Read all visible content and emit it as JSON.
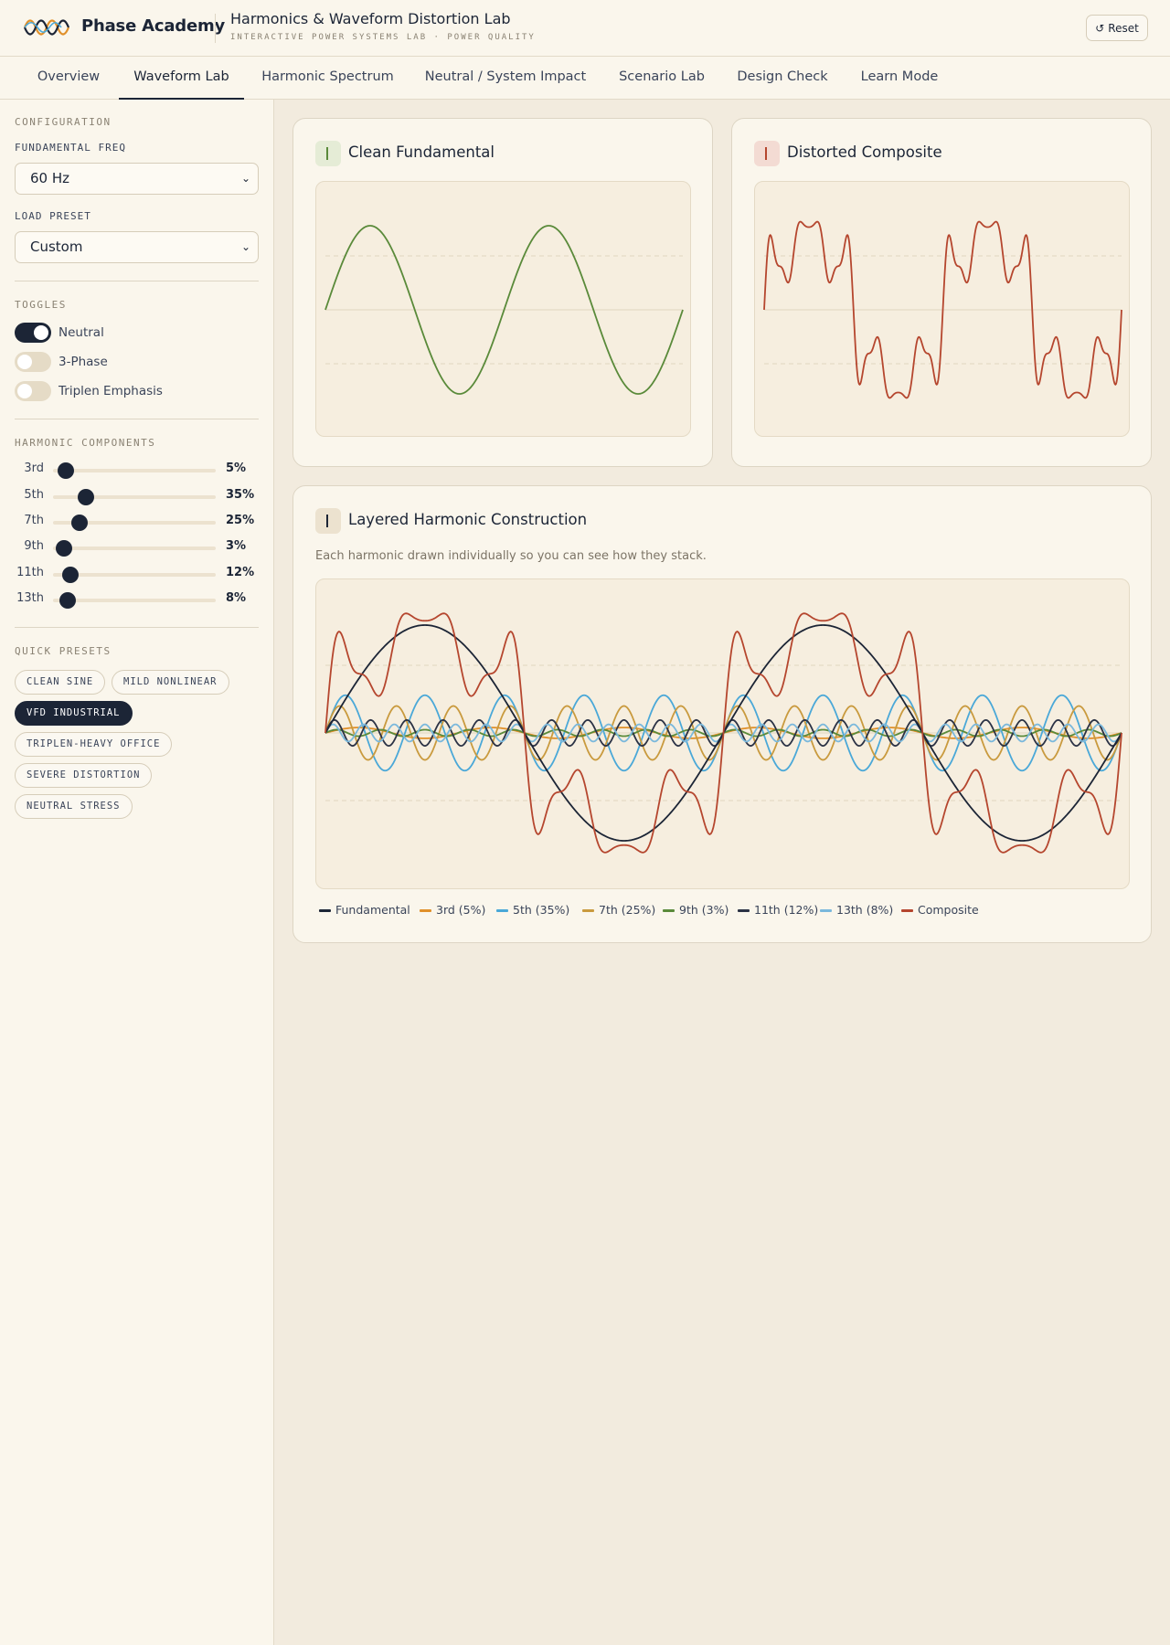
{
  "brand": {
    "name": "Phase Academy"
  },
  "app": {
    "title": "Harmonics & Waveform Distortion Lab",
    "subtitle": "INTERACTIVE POWER SYSTEMS LAB · POWER QUALITY",
    "reset_label": "Reset",
    "reset_icon": "↺"
  },
  "tabs": [
    {
      "label": "Overview"
    },
    {
      "label": "Waveform Lab",
      "active": true
    },
    {
      "label": "Harmonic Spectrum"
    },
    {
      "label": "Neutral / System Impact"
    },
    {
      "label": "Scenario Lab"
    },
    {
      "label": "Design Check"
    },
    {
      "label": "Learn Mode"
    }
  ],
  "sidebar": {
    "configuration_title": "CONFIGURATION",
    "freq_label": "FUNDAMENTAL FREQ",
    "freq_value": "60 Hz",
    "preset_label": "LOAD PRESET",
    "preset_value": "Custom",
    "toggles_title": "TOGGLES",
    "toggles": [
      {
        "label": "Neutral",
        "on": true
      },
      {
        "label": "3-Phase",
        "on": false
      },
      {
        "label": "Triplen Emphasis",
        "on": false
      }
    ],
    "harmonics_title": "HARMONIC COMPONENTS",
    "harmonics": [
      {
        "name": "3rd",
        "order": 3,
        "percent": 5,
        "value_text": "5%"
      },
      {
        "name": "5th",
        "order": 5,
        "percent": 35,
        "value_text": "35%"
      },
      {
        "name": "7th",
        "order": 7,
        "percent": 25,
        "value_text": "25%"
      },
      {
        "name": "9th",
        "order": 9,
        "percent": 3,
        "value_text": "3%"
      },
      {
        "name": "11th",
        "order": 11,
        "percent": 12,
        "value_text": "12%"
      },
      {
        "name": "13th",
        "order": 13,
        "percent": 8,
        "value_text": "8%"
      }
    ],
    "presets_title": "QUICK PRESETS",
    "presets": [
      {
        "label": "CLEAN SINE"
      },
      {
        "label": "MILD NONLINEAR"
      },
      {
        "label": "VFD INDUSTRIAL",
        "active": true
      },
      {
        "label": "TRIPLEN-HEAVY OFFICE"
      },
      {
        "label": "SEVERE DISTORTION"
      },
      {
        "label": "NEUTRAL STRESS"
      }
    ]
  },
  "cards": {
    "clean": {
      "title": "Clean Fundamental",
      "accent": "#5a8a3a"
    },
    "distorted": {
      "title": "Distorted Composite",
      "accent": "#b5462e"
    },
    "layered": {
      "title": "Layered Harmonic Construction",
      "description": "Each harmonic drawn individually so you can see how they stack."
    }
  },
  "colors": {
    "fundamental": "#1c2536",
    "h3": "#e0902a",
    "h5": "#4aa8d8",
    "h7": "#c99a3e",
    "h9": "#5a8a3a",
    "h11": "#2b3245",
    "h13": "#7ab8dc",
    "composite": "#b5462e"
  },
  "chart_data": [
    {
      "type": "line",
      "chart": "clean-fundamental",
      "cycles": 2,
      "series": [
        {
          "color": "#5a8a3a",
          "harmonics": [
            {
              "order": 1,
              "amplitude": 1.0
            }
          ]
        }
      ],
      "grid": true
    },
    {
      "type": "line",
      "chart": "distorted-composite",
      "cycles": 2,
      "series": [
        {
          "color": "#b5462e",
          "harmonics": [
            {
              "order": 1,
              "amplitude": 1.0
            },
            {
              "order": 3,
              "amplitude": 0.05
            },
            {
              "order": 5,
              "amplitude": 0.35
            },
            {
              "order": 7,
              "amplitude": 0.25
            },
            {
              "order": 9,
              "amplitude": 0.03
            },
            {
              "order": 11,
              "amplitude": 0.12
            },
            {
              "order": 13,
              "amplitude": 0.08
            }
          ]
        }
      ],
      "grid": true
    },
    {
      "type": "line",
      "chart": "layered-construction",
      "cycles": 2,
      "series": [
        {
          "name": "Fundamental",
          "order": 1,
          "amplitude": 1.0,
          "color": "#1c2536"
        },
        {
          "name": "3rd (5%)",
          "order": 3,
          "amplitude": 0.05,
          "color": "#e0902a"
        },
        {
          "name": "5th (35%)",
          "order": 5,
          "amplitude": 0.35,
          "color": "#4aa8d8"
        },
        {
          "name": "7th (25%)",
          "order": 7,
          "amplitude": 0.25,
          "color": "#c99a3e"
        },
        {
          "name": "9th (3%)",
          "order": 9,
          "amplitude": 0.03,
          "color": "#5a8a3a"
        },
        {
          "name": "11th (12%)",
          "order": 11,
          "amplitude": 0.12,
          "color": "#2b3245"
        },
        {
          "name": "13th (8%)",
          "order": 13,
          "amplitude": 0.08,
          "color": "#7ab8dc"
        },
        {
          "name": "Composite",
          "composite": true,
          "color": "#b5462e"
        }
      ],
      "grid": true
    }
  ]
}
